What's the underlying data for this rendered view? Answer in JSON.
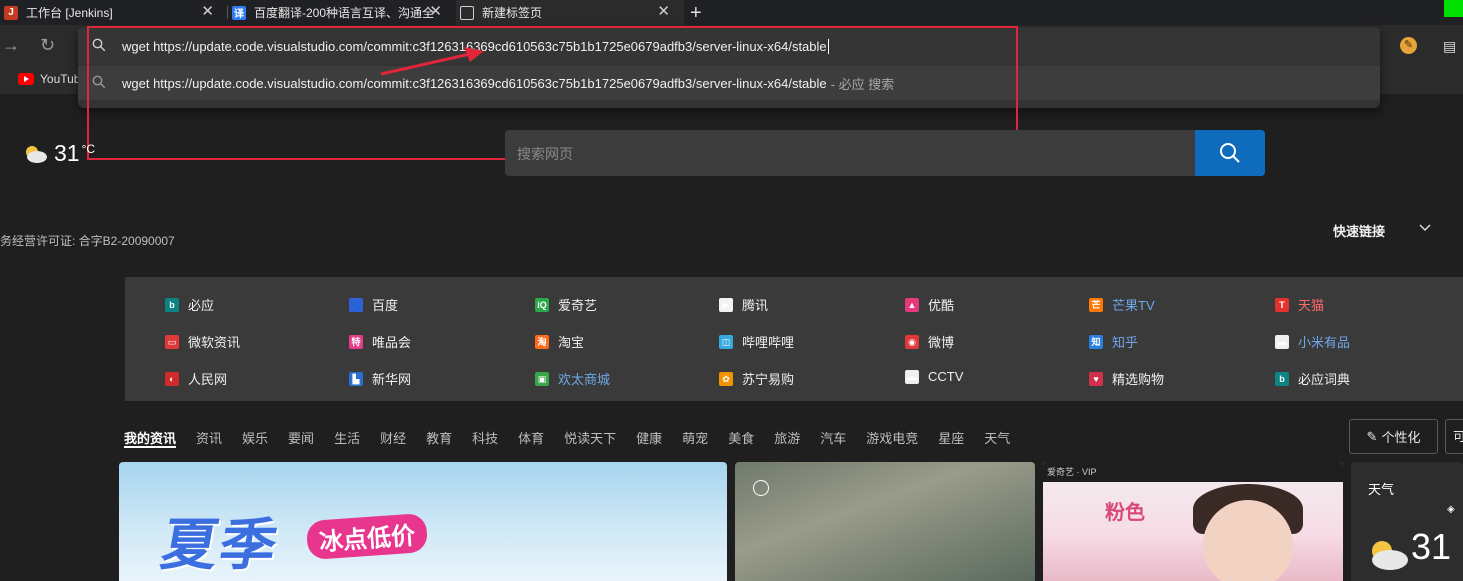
{
  "tabs": [
    {
      "title": "工作台 [Jenkins]",
      "icon": "jenkins-icon"
    },
    {
      "title": "百度翻译-200种语言互译、沟通全",
      "icon": "fanyi-icon"
    },
    {
      "title": "新建标签页",
      "icon": "newtab-icon"
    }
  ],
  "tab_close_glyph": "✕",
  "new_tab_glyph": "+",
  "bookmarks": [
    {
      "label": "YouTube"
    }
  ],
  "omnibox": {
    "input_value": "wget https://update.code.visualstudio.com/commit:c3f126316369cd610563c75b1b1725e0679adfb3/server-linux-x64/stable",
    "suggestion_text": "wget https://update.code.visualstudio.com/commit:c3f126316369cd610563c75b1b1725e0679adfb3/server-linux-x64/stable",
    "suggestion_suffix": "- 必应 搜索"
  },
  "weather": {
    "temp": "31",
    "unit": "°C"
  },
  "search": {
    "placeholder": "搜索网页"
  },
  "license": "务经营许可证: 合字B2-20090007",
  "quick_links": "快速链接",
  "sites": [
    {
      "label": "必应",
      "color": "#0c8484",
      "glyph": "b"
    },
    {
      "label": "百度",
      "color": "#2f62d9",
      "glyph": "🐾"
    },
    {
      "label": "爱奇艺",
      "color": "#2aa84a",
      "glyph": "iQ"
    },
    {
      "label": "腾讯",
      "color": "#f2f2f2",
      "glyph": "▶"
    },
    {
      "label": "优酷",
      "color": "#e43a7a",
      "glyph": "▲"
    },
    {
      "label": "芒果TV",
      "color": "#ff7a00",
      "glyph": "芒"
    },
    {
      "label": "天猫",
      "color": "#e4322f",
      "glyph": "T"
    },
    {
      "label": "微软资讯",
      "color": "#e0393a",
      "glyph": "▭"
    },
    {
      "label": "唯品会",
      "color": "#e83a8a",
      "glyph": "特"
    },
    {
      "label": "淘宝",
      "color": "#ff6a1a",
      "glyph": "淘"
    },
    {
      "label": "哔哩哔哩",
      "color": "#36a9e1",
      "glyph": "◫"
    },
    {
      "label": "微博",
      "color": "#e0393a",
      "glyph": "◉"
    },
    {
      "label": "知乎",
      "color": "#2b7fe0",
      "glyph": "知"
    },
    {
      "label": "小米有品",
      "color": "#f0f0f0",
      "glyph": "▬"
    },
    {
      "label": "人民网",
      "color": "#d12a2a",
      "glyph": "◐"
    },
    {
      "label": "新华网",
      "color": "#2a6fd1",
      "glyph": "▙"
    },
    {
      "label": "欢太商城",
      "color": "#3aa64a",
      "glyph": "▣"
    },
    {
      "label": "苏宁易购",
      "color": "#f29400",
      "glyph": "✿"
    },
    {
      "label": "CCTV",
      "color": "#f0f0f0",
      "glyph": "▬"
    },
    {
      "label": "精选购物",
      "color": "#d1304a",
      "glyph": "♥"
    },
    {
      "label": "必应词典",
      "color": "#0c8484",
      "glyph": "b"
    }
  ],
  "news_tabs": [
    "我的资讯",
    "资讯",
    "娱乐",
    "要闻",
    "生活",
    "财经",
    "教育",
    "科技",
    "体育",
    "悦读天下",
    "健康",
    "萌宠",
    "美食",
    "旅游",
    "汽车",
    "游戏电竞",
    "星座",
    "天气"
  ],
  "personalize": "个性化",
  "personalize2": "可",
  "cards": {
    "promo_big": "夏季",
    "promo_tag": "冰点低价",
    "iqiyi_bar": "爱奇艺 · VIP",
    "iqiyi_title": "粉色",
    "weather_title": "天气",
    "weather_temp": "31"
  },
  "accent_color": "#0f6cbd",
  "annotation_color": "#e0263a"
}
